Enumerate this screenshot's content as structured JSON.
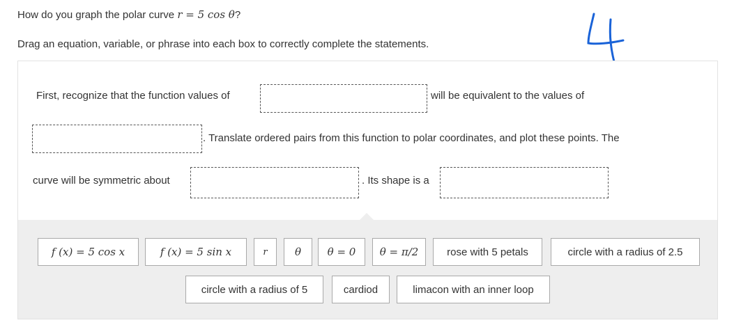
{
  "question": {
    "prefix": "How do you graph the polar curve ",
    "equation": "r = 5 cos θ",
    "suffix": "?",
    "instruction": "Drag an equation, variable, or phrase into each box to correctly complete the statements."
  },
  "handwritten_mark": "4",
  "statements": {
    "part1": "First, recognize that the function values of",
    "part2": "will be equivalent to the values of",
    "part3": ". Translate ordered pairs from this function to polar coordinates, and plot these points. The",
    "part4": "curve will be symmetric about",
    "part5": ". Its shape is a"
  },
  "answer_bank": {
    "tile_f_cos": "f (x) = 5 cos x",
    "tile_f_sin": "f (x) = 5 sin x",
    "tile_r": "r",
    "tile_theta": "θ",
    "tile_theta_zero": "θ = 0",
    "tile_theta_pi2": "θ = π/2",
    "tile_rose": "rose with 5 petals",
    "tile_circle_25": "circle with a radius of 2.5",
    "tile_circle_5": "circle with a radius of 5",
    "tile_cardiod": "cardiod",
    "tile_limacon": "limacon with an inner loop"
  }
}
